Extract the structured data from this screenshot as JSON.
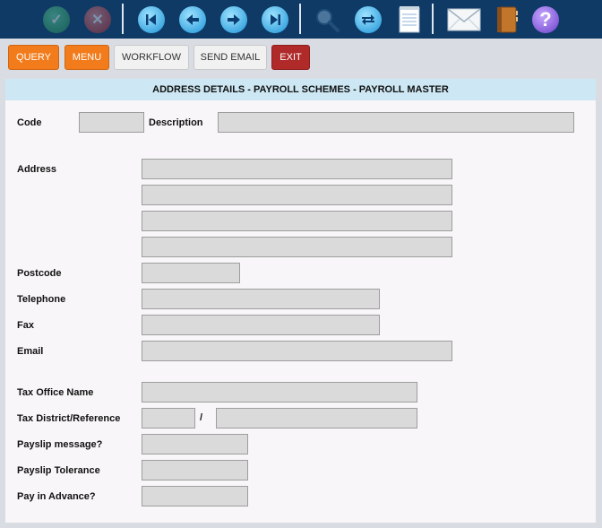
{
  "toolbar": {
    "items": [
      {
        "name": "confirm-icon",
        "glyph": "✓"
      },
      {
        "name": "cancel-icon",
        "glyph": "✕"
      },
      {
        "name": "first-record-icon",
        "glyph": "⏮"
      },
      {
        "name": "previous-record-icon",
        "glyph": "←"
      },
      {
        "name": "next-record-icon",
        "glyph": "→"
      },
      {
        "name": "last-record-icon",
        "glyph": "⏭"
      },
      {
        "name": "search-icon",
        "glyph": ""
      },
      {
        "name": "refresh-icon",
        "glyph": "⇄"
      },
      {
        "name": "notepad-icon",
        "glyph": ""
      },
      {
        "name": "email-icon",
        "glyph": ""
      },
      {
        "name": "address-book-icon",
        "glyph": ""
      },
      {
        "name": "help-icon",
        "glyph": "?"
      }
    ]
  },
  "actions": {
    "query": "QUERY",
    "menu": "MENU",
    "workflow": "WORKFLOW",
    "send_email": "SEND EMAIL",
    "exit": "EXIT"
  },
  "form": {
    "title": "ADDRESS DETAILS - PAYROLL SCHEMES - PAYROLL MASTER",
    "labels": {
      "code": "Code",
      "description": "Description",
      "address": "Address",
      "postcode": "Postcode",
      "telephone": "Telephone",
      "fax": "Fax",
      "email": "Email",
      "tax_office_name": "Tax Office Name",
      "tax_district_reference": "Tax District/Reference",
      "tax_separator": "/",
      "payslip_message": "Payslip message?",
      "payslip_tolerance": "Payslip Tolerance",
      "pay_in_advance": "Pay in Advance?"
    },
    "values": {
      "code": "",
      "description": "",
      "address_line1": "",
      "address_line2": "",
      "address_line3": "",
      "address_line4": "",
      "postcode": "",
      "telephone": "",
      "fax": "",
      "email": "",
      "tax_office_name": "",
      "tax_district": "",
      "tax_reference": "",
      "payslip_message": "",
      "payslip_tolerance": "",
      "pay_in_advance": ""
    }
  },
  "colors": {
    "toolbar_bg": "#0f3a66",
    "orange_button": "#f27c1c",
    "exit_button": "#b02a2a",
    "title_bar": "#cde8f4",
    "field_bg": "#dadada"
  }
}
